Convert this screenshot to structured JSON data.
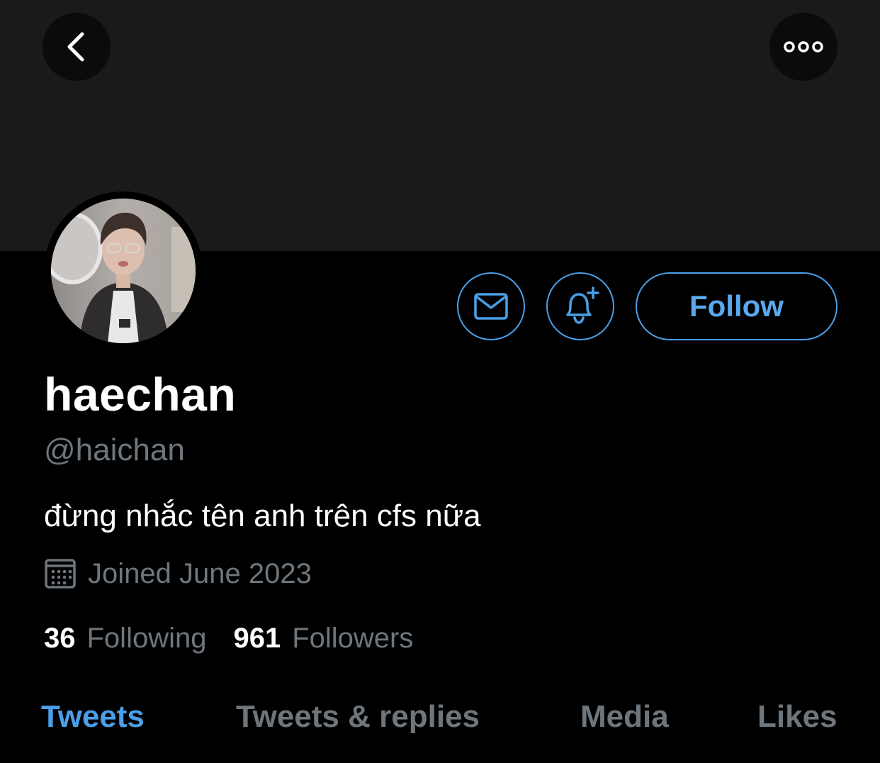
{
  "header": {
    "back_icon": "chevron-left-icon",
    "more_icon": "more-horizontal-icon"
  },
  "profile": {
    "display_name": "haechan",
    "handle": "@haichan",
    "bio": "đừng nhắc tên anh trên cfs nữa",
    "joined": "Joined June 2023"
  },
  "actions": {
    "message_icon": "mail-icon",
    "notify_icon": "bell-plus-icon",
    "follow_label": "Follow"
  },
  "stats": {
    "following_count": "36",
    "following_label": "Following",
    "followers_count": "961",
    "followers_label": "Followers"
  },
  "tabs": [
    {
      "label": "Tweets",
      "active": true
    },
    {
      "label": "Tweets & replies",
      "active": false
    },
    {
      "label": "Media",
      "active": false
    },
    {
      "label": "Likes",
      "active": false
    }
  ],
  "colors": {
    "accent": "#4a9fe8",
    "muted": "#6e767d",
    "background": "#000000",
    "banner": "#1a1a1a"
  }
}
